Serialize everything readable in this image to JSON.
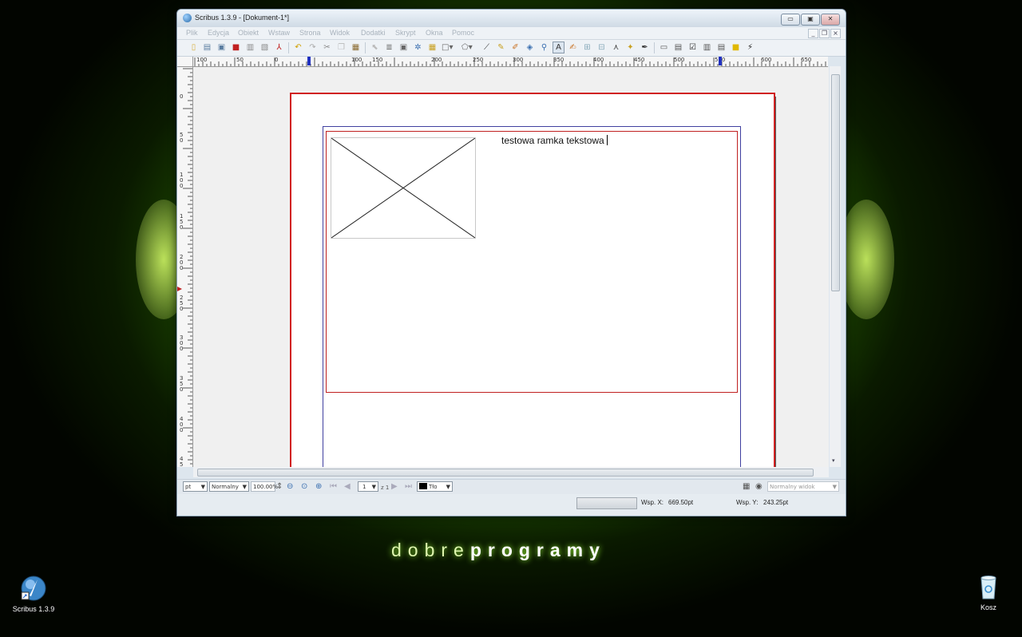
{
  "window": {
    "title": "Scribus 1.3.9 - [Dokument-1*]",
    "btn_min": "▭",
    "btn_max": "▣",
    "btn_close": "✕",
    "mdi_min": "_",
    "mdi_restore": "❐",
    "mdi_close": "×"
  },
  "menu": [
    "Plik",
    "Edycja",
    "Obiekt",
    "Wstaw",
    "Strona",
    "Widok",
    "Dodatki",
    "Skrypt",
    "Okna",
    "Pomoc"
  ],
  "ruler": {
    "h_labels": [
      "100",
      "50",
      "0",
      "50",
      "100",
      "150",
      "200",
      "250",
      "300",
      "350",
      "400",
      "450",
      "500",
      "550",
      "600",
      "650"
    ],
    "v_labels": [
      "0",
      "5 0",
      "1 0 0",
      "1 5 0",
      "2 0 0",
      "2 5 0",
      "3 0 0",
      "3 5 0",
      "4 0 0",
      "4 5"
    ]
  },
  "document": {
    "frame_text": "testowa ramka tekstowa"
  },
  "bottombar": {
    "unit": "pt",
    "mode": "Normalny",
    "zoom": "100.00%",
    "page": "1",
    "page_total": "z 1",
    "layer": "Tło",
    "preview_mode": "Normalny widok"
  },
  "status": {
    "x_label": "Wsp. X:",
    "x_value": "669.50pt",
    "y_label": "Wsp. Y:",
    "y_value": "243.25pt"
  },
  "desktop": {
    "brand_light": "dobre",
    "brand_bold": "programy",
    "icon_scribus": "Scribus 1.3.9",
    "icon_trash": "Kosz"
  },
  "colors": {
    "page_border": "#d02020",
    "margin_guide": "#4040a0",
    "frame_border": "#c02020"
  },
  "icons": {
    "toolbar": [
      "new-icon",
      "open-icon",
      "save-icon",
      "close-doc-icon",
      "print-icon",
      "preflight-icon",
      "pdf-icon",
      "undo-icon",
      "redo-icon",
      "cut-icon",
      "copy-icon",
      "paste-icon",
      "select-icon",
      "text-frame-icon",
      "image-frame-icon",
      "render-frame-icon",
      "table-icon",
      "shape-icon",
      "polygon-icon",
      "line-icon",
      "bezier-icon",
      "freehand-icon",
      "rotate-icon",
      "zoom-icon",
      "edit-text-icon",
      "story-editor-icon",
      "link-frames-icon",
      "unlink-frames-icon",
      "measure-icon",
      "copy-properties-icon",
      "eyedropper-icon",
      "pdf-button-icon",
      "pdf-textfield-icon",
      "pdf-checkbox-icon",
      "pdf-combobox-icon",
      "pdf-listbox-icon",
      "pdf-annotation-icon",
      "pdf-link-icon"
    ]
  }
}
